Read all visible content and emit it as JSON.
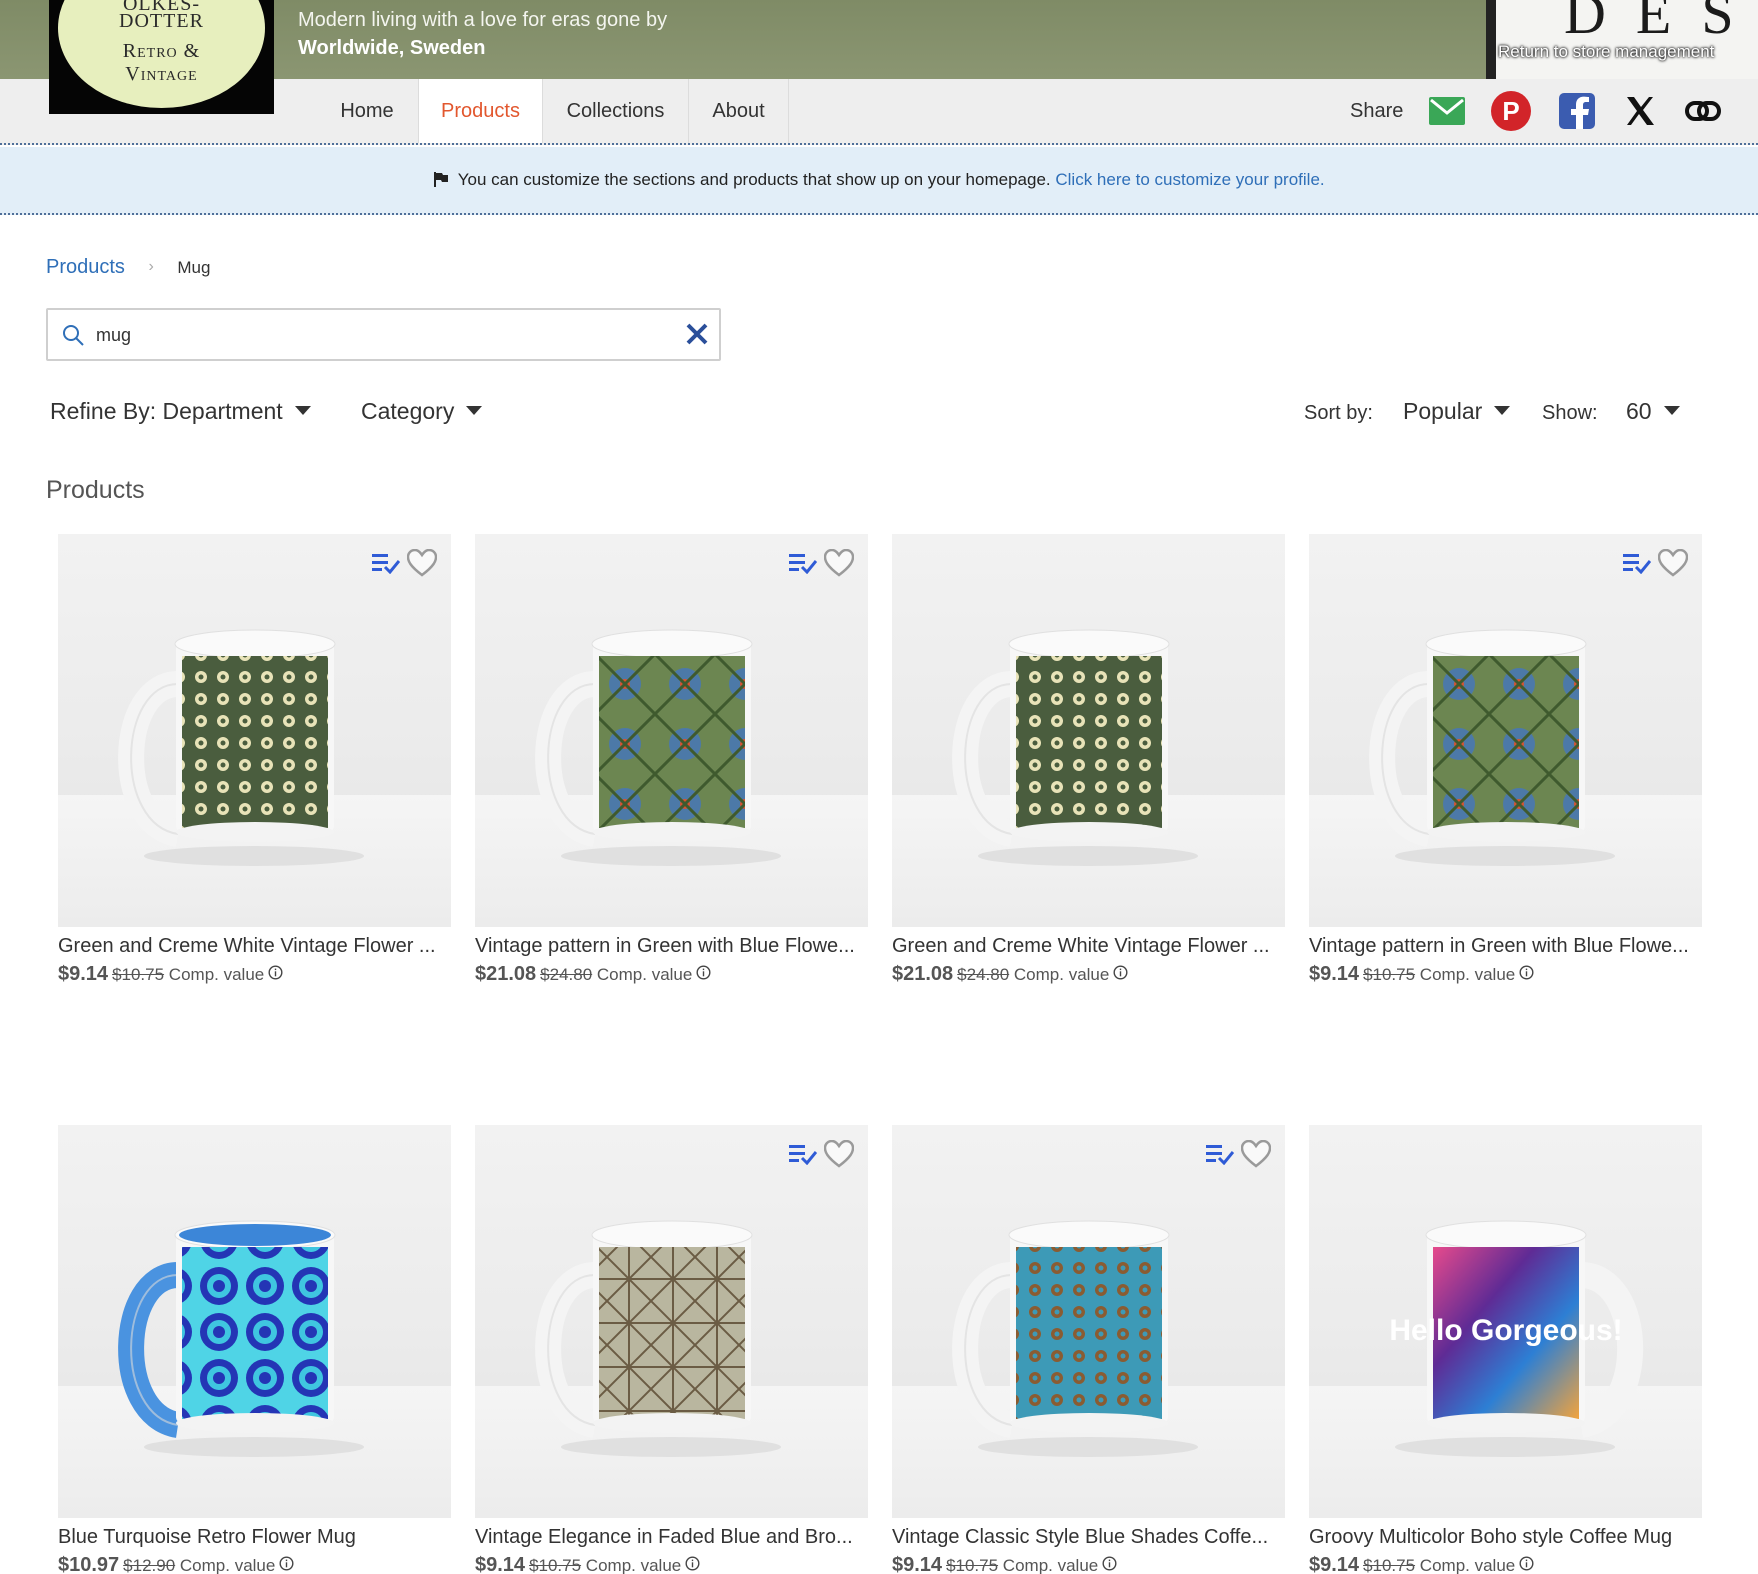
{
  "header": {
    "logo_top": "OLKES-\nDOTTER",
    "logo_bottom": "Retro &\nVintage",
    "tagline": "Modern living with a love for eras gone by",
    "location": "Worldwide, Sweden",
    "store_letters": "DES",
    "store_management_link": "Return to store management"
  },
  "nav": {
    "tabs": [
      {
        "label": "Home",
        "active": false
      },
      {
        "label": "Products",
        "active": true
      },
      {
        "label": "Collections",
        "active": false
      },
      {
        "label": "About",
        "active": false
      }
    ],
    "share_label": "Share",
    "share_icons": [
      "email-icon",
      "pinterest-icon",
      "facebook-icon",
      "x-icon",
      "link-icon"
    ]
  },
  "notice": {
    "text": "You can customize the sections and products that show up on your homepage.",
    "link": "Click here to customize your profile."
  },
  "breadcrumb": {
    "root": "Products",
    "current": "Mug"
  },
  "search": {
    "value": "mug"
  },
  "filters": {
    "department": "Refine By: Department",
    "category": "Category",
    "sort_label": "Sort by:",
    "sort_value": "Popular",
    "show_label": "Show:",
    "show_value": "60"
  },
  "section_title": "Products",
  "products": [
    {
      "title": "Green and Creme White Vintage Flower ...",
      "price": "$9.14",
      "compare": "$10.75",
      "compare_label": "Comp. value",
      "actions": true,
      "mug": "green-cream"
    },
    {
      "title": "Vintage pattern in Green with Blue Flowe...",
      "price": "$21.08",
      "compare": "$24.80",
      "compare_label": "Comp. value",
      "actions": true,
      "mug": "green-blue"
    },
    {
      "title": "Green and Creme White Vintage Flower ...",
      "price": "$21.08",
      "compare": "$24.80",
      "compare_label": "Comp. value",
      "actions": false,
      "mug": "green-cream"
    },
    {
      "title": "Vintage pattern in Green with Blue Flowe...",
      "price": "$9.14",
      "compare": "$10.75",
      "compare_label": "Comp. value",
      "actions": true,
      "mug": "green-blue"
    },
    {
      "title": "Blue Turquoise Retro Flower Mug",
      "price": "$10.97",
      "compare": "$12.90",
      "compare_label": "Comp. value",
      "actions": false,
      "mug": "turquoise"
    },
    {
      "title": "Vintage Elegance in Faded Blue and Bro...",
      "price": "$9.14",
      "compare": "$10.75",
      "compare_label": "Comp. value",
      "actions": true,
      "mug": "faded"
    },
    {
      "title": "Vintage Classic Style Blue Shades Coffe...",
      "price": "$9.14",
      "compare": "$10.75",
      "compare_label": "Comp. value",
      "actions": true,
      "mug": "blue-shades"
    },
    {
      "title": "Groovy Multicolor Boho style Coffee Mug",
      "price": "$9.14",
      "compare": "$10.75",
      "compare_label": "Comp. value",
      "actions": false,
      "mug": "groovy",
      "mug_text": "Hello Gorgeous!"
    }
  ],
  "colors": {
    "banner": "#8b9672",
    "active_tab": "#e2572e",
    "link": "#2f6fb8",
    "notice_bg": "#e2eef8",
    "action_blue": "#2f5bd6"
  }
}
